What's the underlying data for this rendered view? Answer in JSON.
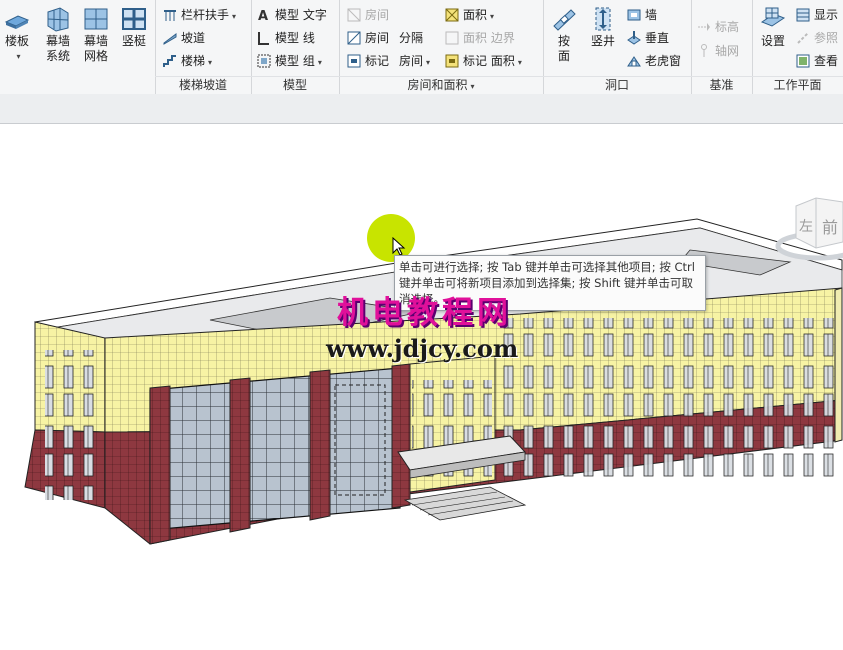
{
  "ribbon": {
    "buttons": {
      "floor": "楼板",
      "curtain_system": "幕墙\n系统",
      "curtain_grid": "幕墙\n网格",
      "mullion": "竖梃",
      "by_face": "按\n面",
      "shaft": "竖井",
      "set": "设置"
    },
    "circulation": {
      "railing": "栏杆扶手",
      "ramp": "坡道",
      "stair": "楼梯",
      "panel_label": "楼梯坡道"
    },
    "model": {
      "model_text": "模型 文字",
      "model_line": "模型 线",
      "model_group": "模型 组",
      "panel_label": "模型"
    },
    "room_area": {
      "room_top": "房间",
      "room": "房间",
      "room_separator": "分隔",
      "tag_room_1": "标记",
      "tag_room_2": "房间",
      "area": "面积",
      "area_boundary_1": "面积",
      "area_boundary_2": "边界",
      "tag_area_1": "标记",
      "tag_area_2": "面积",
      "panel_label": "房间和面积"
    },
    "opening": {
      "wall": "墙",
      "vertical": "垂直",
      "dormer": "老虎窗",
      "panel_label": "洞口"
    },
    "datum": {
      "level": "标高",
      "grid": "轴网",
      "panel_label": "基准"
    },
    "work_plane": {
      "show": "显示",
      "ref_plane": "参照",
      "viewer": "查看",
      "panel_label": "工作平面"
    }
  },
  "viewcube": {
    "left": "左",
    "front": "前"
  },
  "tooltip": {
    "text": "单击可进行选择; 按 Tab 键并单击可选择其他项目; 按 Ctrl 键并单击可将新项目添加到选择集; 按 Shift 键并单击可取消选择。"
  },
  "watermark": {
    "title": "机电教程网",
    "url": "www.jdjcy.com"
  },
  "colors": {
    "ribbon_bg": "#f5f6f7",
    "facade_yellow": "#f7f3a4",
    "base_brick": "#8e3840",
    "glass": "#aab7c4",
    "cursor_highlight": "#c8e400",
    "watermark_magenta": "#e0109a"
  }
}
